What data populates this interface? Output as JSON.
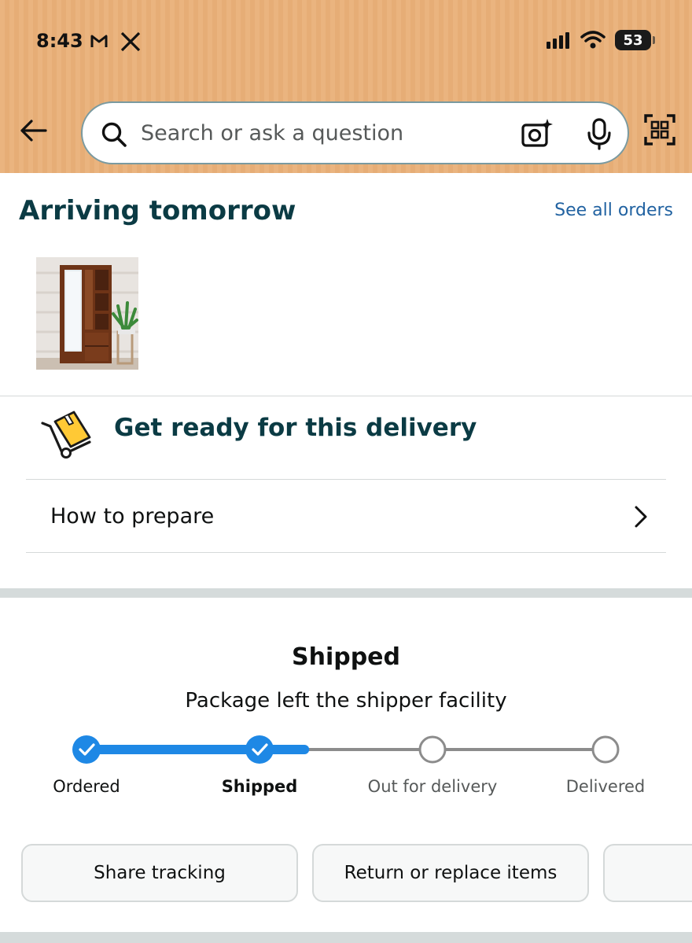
{
  "status_bar": {
    "time": "8:43",
    "battery": "53",
    "icons": [
      "gmail-m-icon",
      "x-logo-icon",
      "signal-icon",
      "wifi-icon",
      "battery-icon"
    ]
  },
  "header": {
    "background_color": "#e9b27c",
    "search_placeholder": "Search or ask a question",
    "icons": [
      "back-arrow-icon",
      "search-icon",
      "camera-lens-icon",
      "microphone-icon",
      "qr-scan-icon"
    ]
  },
  "arriving": {
    "title": "Arriving tomorrow",
    "see_all_label": "See all orders",
    "product_image": "wooden-wardrobe-with-mirror"
  },
  "delivery_prep": {
    "title": "Get ready for this delivery",
    "row_label": "How to prepare"
  },
  "tracking": {
    "status_title": "Shipped",
    "status_subtitle": "Package left the shipper facility",
    "progress_color": "#1e88e5",
    "steps": [
      {
        "label": "Ordered",
        "state": "done"
      },
      {
        "label": "Shipped",
        "state": "current"
      },
      {
        "label": "Out for delivery",
        "state": "pending"
      },
      {
        "label": "Delivered",
        "state": "pending"
      }
    ],
    "progress_fraction": 0.42
  },
  "actions": {
    "share_label": "Share tracking",
    "return_label": "Return or replace items"
  }
}
